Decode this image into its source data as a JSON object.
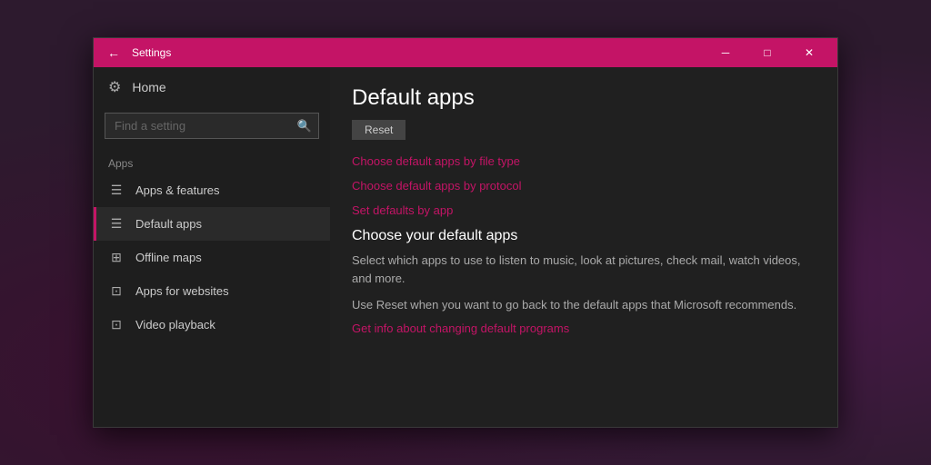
{
  "window": {
    "title": "Settings",
    "back_icon": "←",
    "minimize_icon": "─",
    "maximize_icon": "□",
    "close_icon": "✕"
  },
  "sidebar": {
    "home_label": "Home",
    "home_icon": "⚙",
    "search_placeholder": "Find a setting",
    "search_icon": "🔍",
    "section_label": "Apps",
    "nav_items": [
      {
        "label": "Apps & features",
        "icon": "☰",
        "active": false
      },
      {
        "label": "Default apps",
        "icon": "☰",
        "active": true
      },
      {
        "label": "Offline maps",
        "icon": "🗺",
        "active": false
      },
      {
        "label": "Apps for websites",
        "icon": "⊡",
        "active": false
      },
      {
        "label": "Video playback",
        "icon": "⊡",
        "active": false
      }
    ]
  },
  "main": {
    "page_title": "Default apps",
    "reset_button_label": "Reset",
    "links": [
      "Choose default apps by file type",
      "Choose default apps by protocol",
      "Set defaults by app"
    ],
    "section_title": "Choose your default apps",
    "description": "Select which apps to use to listen to music, look at pictures, check mail, watch videos, and more.",
    "reset_description": "Use Reset when you want to go back to the default apps that Microsoft recommends.",
    "info_link": "Get info about changing default programs"
  }
}
